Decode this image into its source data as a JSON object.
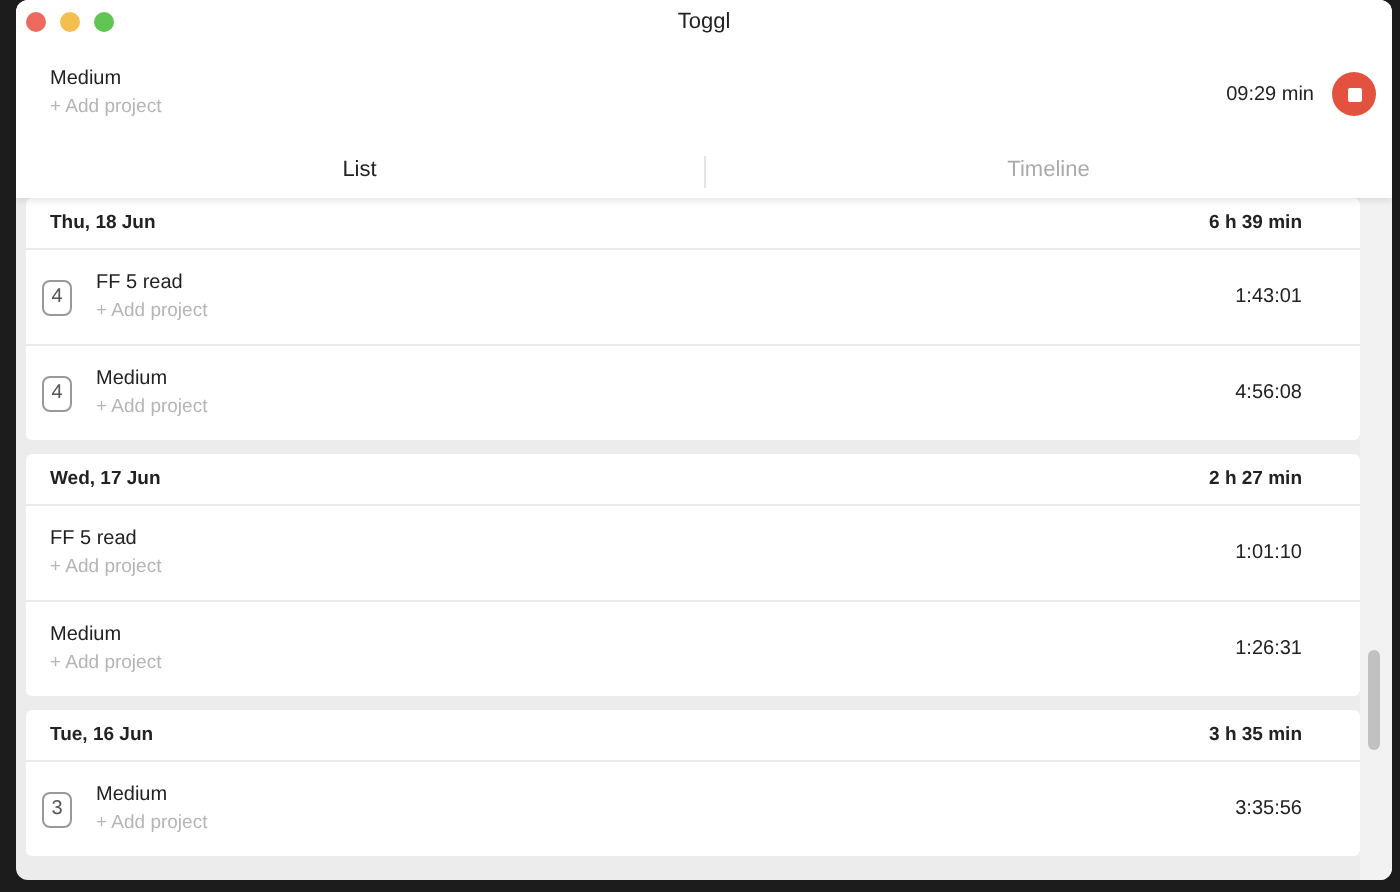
{
  "window": {
    "title": "Toggl"
  },
  "timer": {
    "description": "Medium",
    "project": "+ Add project",
    "duration": "09:29 min"
  },
  "tabs": [
    {
      "label": "List",
      "selected": true
    },
    {
      "label": "Timeline",
      "selected": false
    }
  ],
  "days": [
    {
      "date": "Thu, 18 Jun",
      "total": "6 h 39 min",
      "entries": [
        {
          "count": "4",
          "description": "FF 5 read",
          "project": "+ Add project",
          "duration": "1:43:01"
        },
        {
          "count": "4",
          "description": "Medium",
          "project": "+ Add project",
          "duration": "4:56:08"
        }
      ]
    },
    {
      "date": "Wed, 17 Jun",
      "total": "2 h 27 min",
      "entries": [
        {
          "description": "FF 5 read",
          "project": "+ Add project",
          "duration": "1:01:10"
        },
        {
          "description": "Medium",
          "project": "+ Add project",
          "duration": "1:26:31"
        }
      ]
    },
    {
      "date": "Tue, 16 Jun",
      "total": "3 h 35 min",
      "entries": [
        {
          "count": "3",
          "description": "Medium",
          "project": "+ Add project",
          "duration": "3:35:56"
        }
      ]
    }
  ]
}
